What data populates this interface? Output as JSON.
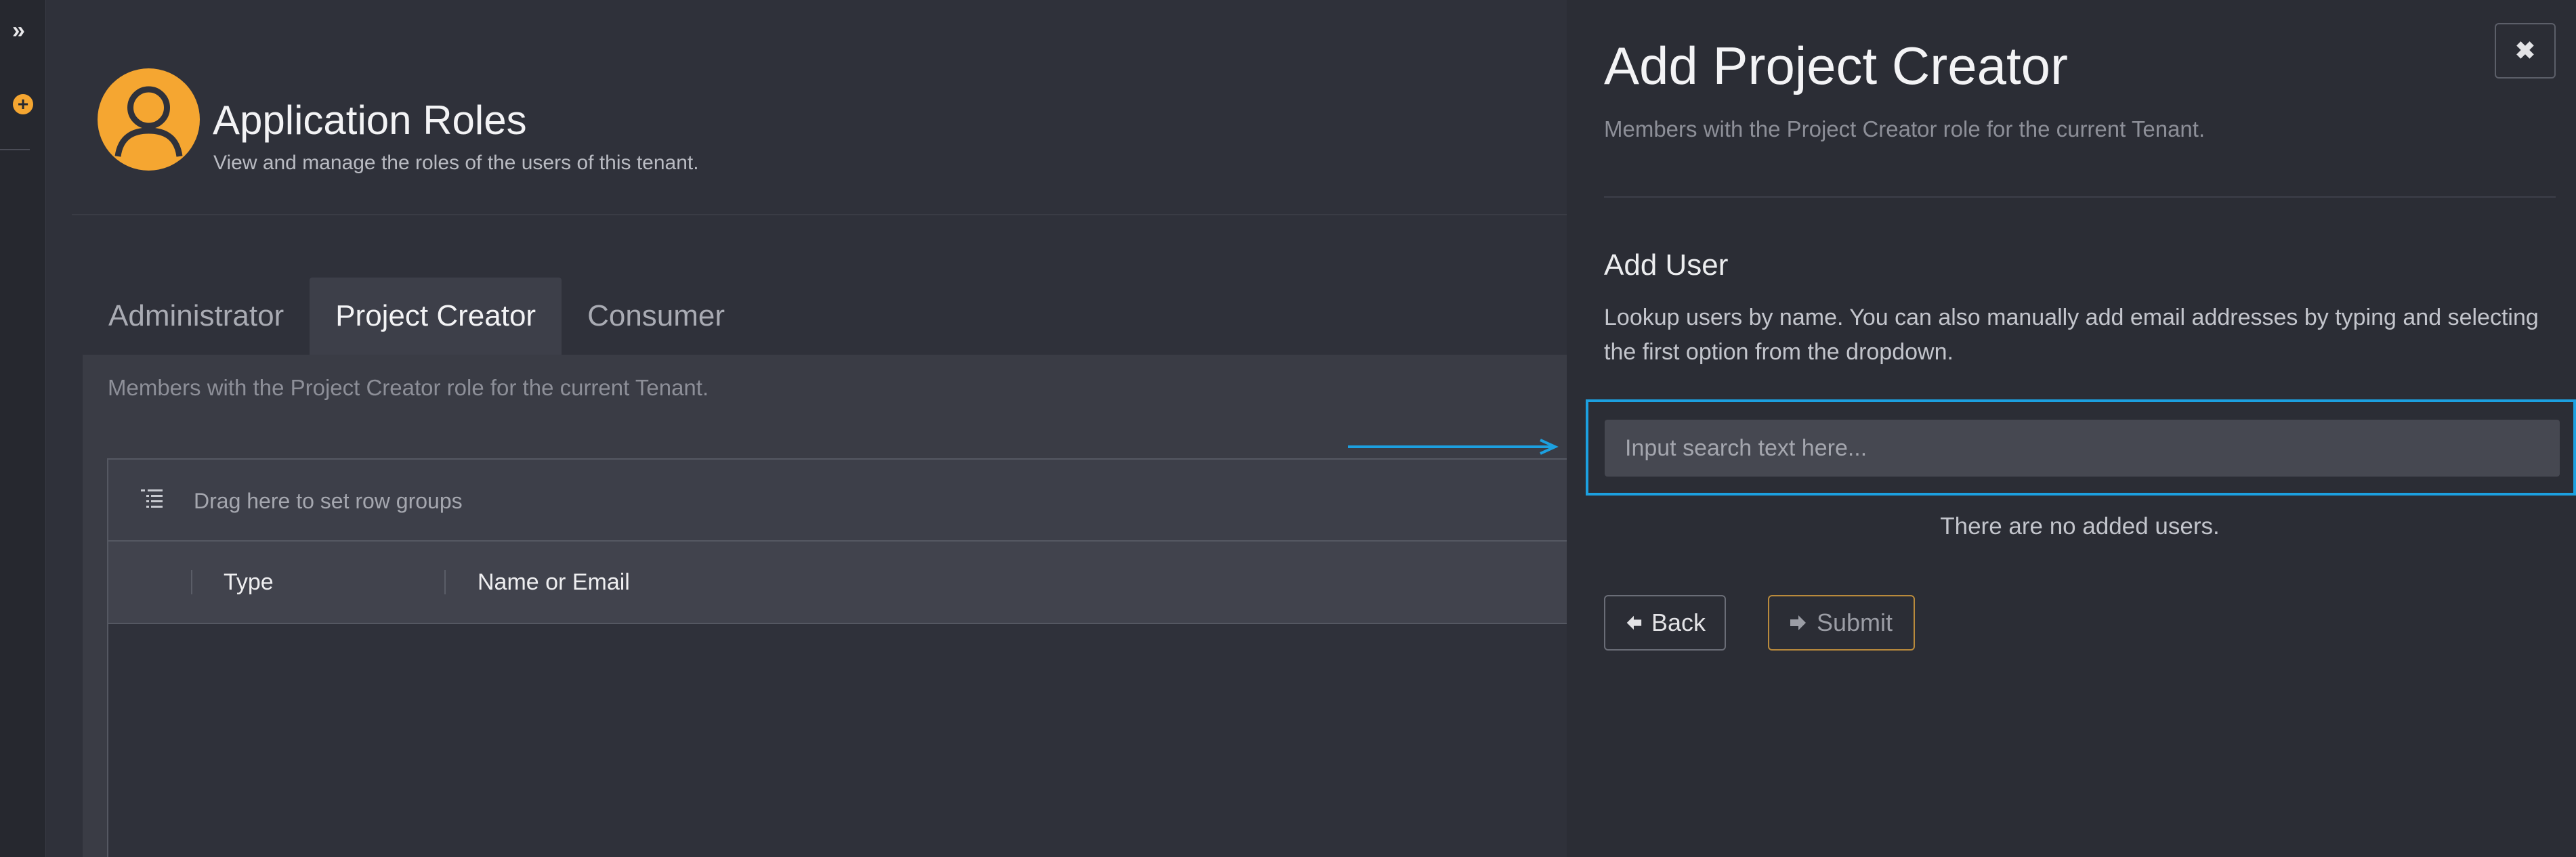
{
  "rail": {
    "expand_icon": "double-chevron-right-icon",
    "add_icon": "plus-circle-icon",
    "expand_glyph": "»",
    "add_glyph": "+"
  },
  "page": {
    "title": "Application Roles",
    "subtitle": "View and manage the roles of the users of this tenant.",
    "avatar_icon": "user-avatar-icon"
  },
  "tabs": [
    {
      "label": "Administrator",
      "active": false
    },
    {
      "label": "Project Creator",
      "active": true
    },
    {
      "label": "Consumer",
      "active": false
    }
  ],
  "panel": {
    "description": "Members with the Project Creator role for the current Tenant."
  },
  "grid": {
    "group_placeholder": "Drag here to set row groups",
    "columns": [
      "Type",
      "Name or Email"
    ]
  },
  "drawer": {
    "title": "Add Project Creator",
    "subtitle": "Members with the Project Creator role for the current Tenant.",
    "close_glyph": "✖",
    "section_title": "Add User",
    "help_text": "Lookup users by name. You can also manually add email addresses by typing and selecting the first option from the dropdown.",
    "search_placeholder": "Input search text here...",
    "search_value": "",
    "empty_message": "There are no added users.",
    "back_label": "Back",
    "submit_label": "Submit"
  },
  "colors": {
    "accent": "#f5a631",
    "highlight": "#1ca0e0",
    "background": "#2f313a",
    "drawer_background": "#2b2d35"
  }
}
